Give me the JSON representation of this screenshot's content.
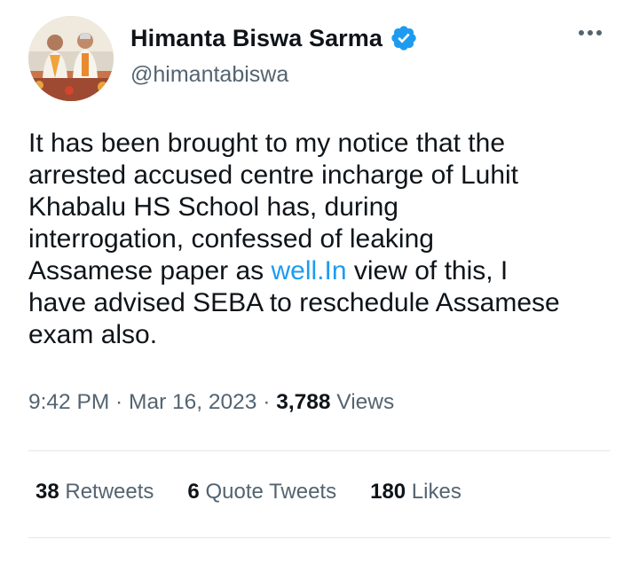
{
  "author": {
    "display_name": "Himanta Biswa Sarma",
    "handle": "@himantabiswa",
    "verified_icon": "verified-badge-icon",
    "avatar": "profile-photo"
  },
  "tweet": {
    "text_part1": "It has been brought to my notice that the\narrested accused centre incharge of Luhit\nKhabalu HS School has, during\ninterrogation, confessed of leaking\nAssamese paper as ",
    "link_text": "well.In",
    "text_part2": " view of this, I\nhave advised SEBA to reschedule Assamese\nexam also."
  },
  "meta": {
    "time": "9:42 PM",
    "sep1": " · ",
    "date": "Mar 16, 2023",
    "sep2": " · ",
    "views_count": "3,788",
    "views_label": " Views"
  },
  "stats": {
    "retweets_count": "38",
    "retweets_label": " Retweets",
    "quotes_count": "6",
    "quotes_label": " Quote Tweets",
    "likes_count": "180",
    "likes_label": " Likes"
  },
  "colors": {
    "link": "#1d9bf0",
    "verified": "#1d9bf0",
    "secondary_text": "#536471",
    "primary_text": "#0f1419"
  }
}
